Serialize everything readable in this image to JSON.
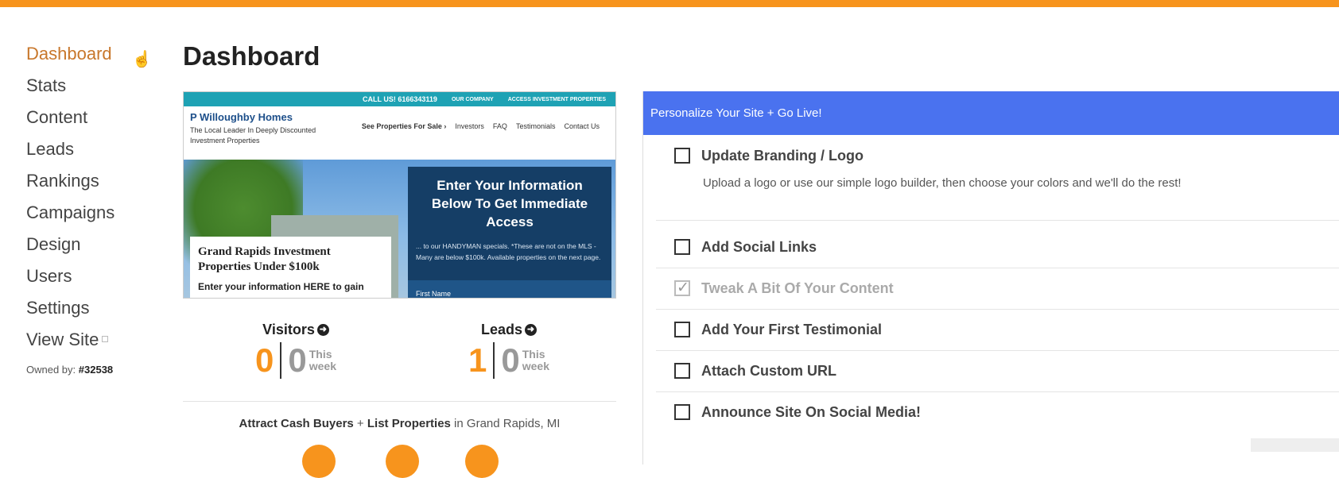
{
  "sidebar": {
    "items": [
      {
        "label": "Dashboard"
      },
      {
        "label": "Stats"
      },
      {
        "label": "Content"
      },
      {
        "label": "Leads"
      },
      {
        "label": "Rankings"
      },
      {
        "label": "Campaigns"
      },
      {
        "label": "Design"
      },
      {
        "label": "Users"
      },
      {
        "label": "Settings"
      },
      {
        "label": "View Site"
      }
    ],
    "owned_label": "Owned by:",
    "owned_value": "#32538"
  },
  "page": {
    "title": "Dashboard"
  },
  "preview": {
    "call": "CALL US! 6166343119",
    "our_company": "OUR COMPANY",
    "access": "ACCESS INVESTMENT PROPERTIES",
    "brand": "P Willoughby Homes",
    "tagline": "The Local Leader In Deeply Discounted Investment Properties",
    "menu": [
      "See Properties For Sale ›",
      "Investors",
      "FAQ",
      "Testimonials",
      "Contact Us"
    ],
    "card_title": "Grand Rapids Investment Properties Under $100k",
    "card_sub": "Enter your information HERE to gain",
    "form_title": "Enter Your Information Below To Get Immediate Access",
    "form_text": "... to our HANDYMAN specials. *These are not on the MLS - Many are below $100k. Available properties on the next page.",
    "form_field": "First Name"
  },
  "stats": {
    "visitors": {
      "label": "Visitors",
      "total": "0",
      "week": "0"
    },
    "leads": {
      "label": "Leads",
      "total": "1",
      "week": "0"
    },
    "week_line1": "This",
    "week_line2": "week"
  },
  "attract": {
    "part1": "Attract Cash Buyers",
    "plus": " + ",
    "part2": "List Properties",
    "part3": " in Grand Rapids, MI"
  },
  "panel": {
    "header": "Personalize Your Site + Go Live!",
    "tasks": [
      {
        "title": "Update Branding / Logo",
        "desc": "Upload a logo or use our simple logo builder, then choose your colors and we'll do the rest!",
        "done": false
      },
      {
        "title": "Add Social Links",
        "done": false
      },
      {
        "title": "Tweak A Bit Of Your Content",
        "done": true
      },
      {
        "title": "Add Your First Testimonial",
        "done": false
      },
      {
        "title": "Attach Custom URL",
        "done": false
      },
      {
        "title": "Announce Site On Social Media!",
        "done": false
      }
    ]
  },
  "colors": {
    "accent": "#f7941d",
    "panel_header": "#4a72ef",
    "active_nav": "#c8772b"
  }
}
